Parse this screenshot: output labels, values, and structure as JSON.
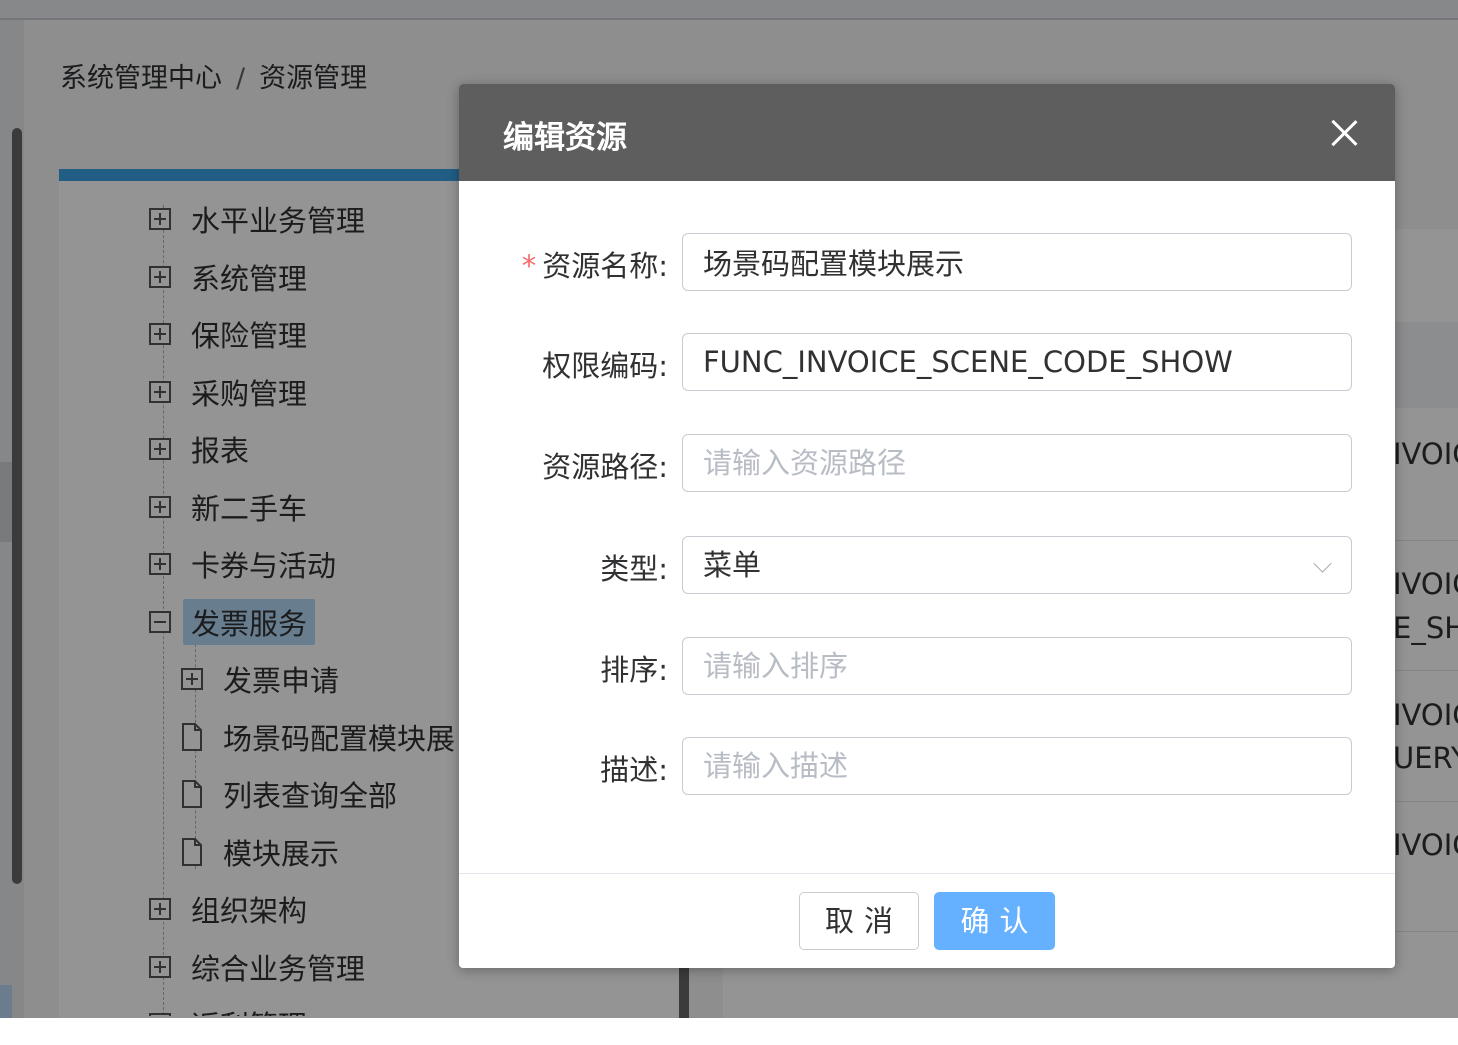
{
  "breadcrumb": {
    "root": "系统管理中心",
    "separator": "/",
    "current": "资源管理"
  },
  "tree": {
    "nodes": [
      {
        "label": "水平业务管理",
        "icon": "plus-square-icon"
      },
      {
        "label": "系统管理",
        "icon": "plus-square-icon"
      },
      {
        "label": "保险管理",
        "icon": "plus-square-icon"
      },
      {
        "label": "采购管理",
        "icon": "plus-square-icon"
      },
      {
        "label": "报表",
        "icon": "plus-square-icon"
      },
      {
        "label": "新二手车",
        "icon": "plus-square-icon"
      },
      {
        "label": "卡券与活动",
        "icon": "plus-square-icon"
      },
      {
        "label": "发票服务",
        "icon": "minus-square-icon",
        "selected": true
      },
      {
        "label": "发票申请",
        "icon": "plus-square-icon",
        "child": true
      },
      {
        "label": "场景码配置模块展",
        "icon": "document-icon",
        "child": true
      },
      {
        "label": "列表查询全部",
        "icon": "document-icon",
        "child": true
      },
      {
        "label": "模块展示",
        "icon": "document-icon",
        "child": true
      },
      {
        "label": "组织架构",
        "icon": "plus-square-icon"
      },
      {
        "label": "综合业务管理",
        "icon": "plus-square-icon"
      },
      {
        "label": "返利管理",
        "icon": "plus-square-icon"
      }
    ]
  },
  "background_table": {
    "cells": [
      "IVOIC",
      "IVOIC",
      "E_SH",
      "IVOIC",
      "UERY",
      "IVOIC"
    ]
  },
  "dialog": {
    "title": "编辑资源",
    "fields": {
      "name": {
        "label": "资源名称:",
        "required_mark": "*",
        "value": "场景码配置模块展示"
      },
      "code": {
        "label": "权限编码:",
        "value": "FUNC_INVOICE_SCENE_CODE_SHOW"
      },
      "path": {
        "label": "资源路径:",
        "placeholder": "请输入资源路径",
        "value": ""
      },
      "type": {
        "label": "类型:",
        "value": "菜单"
      },
      "sort": {
        "label": "排序:",
        "placeholder": "请输入排序",
        "value": ""
      },
      "desc": {
        "label": "描述:",
        "placeholder": "请输入描述",
        "value": ""
      }
    },
    "buttons": {
      "cancel": "取消",
      "confirm": "确认"
    }
  },
  "colors": {
    "primary": "#66b1ff",
    "header": "#5e5e5e",
    "required": "#f56c6c",
    "tree_selected": "#b3d8f5"
  }
}
